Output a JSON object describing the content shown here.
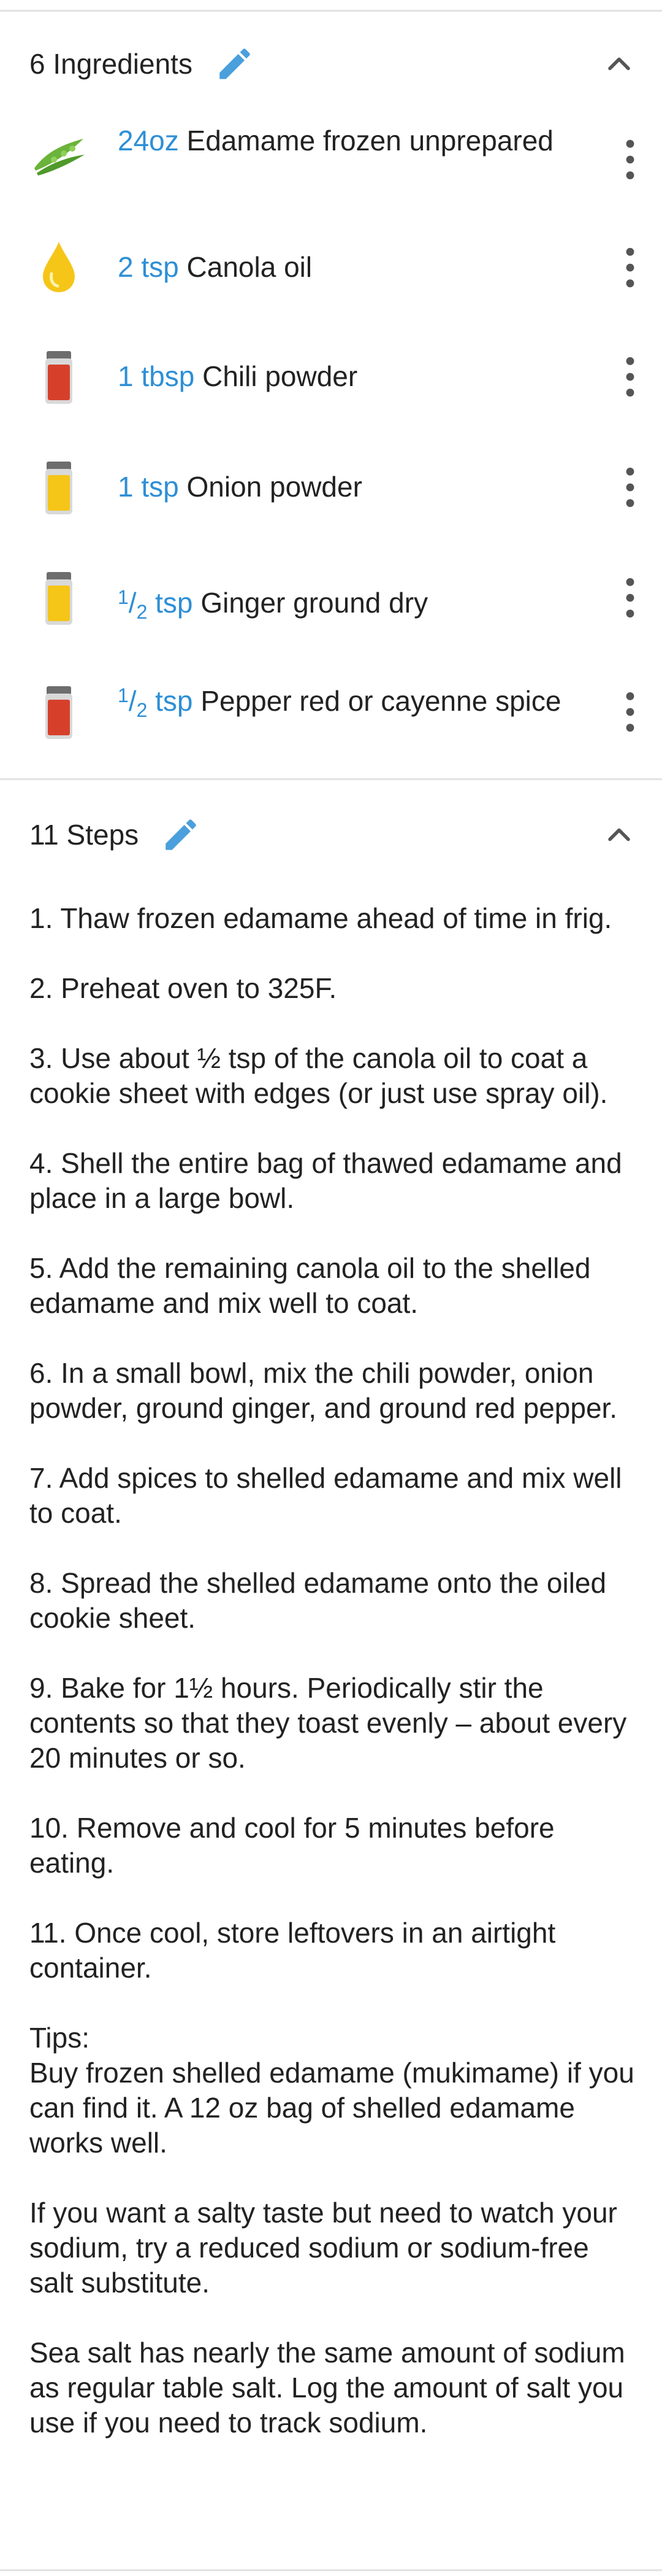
{
  "ingredients_section": {
    "title": "6 Ingredients",
    "items": [
      {
        "icon": "edamame-icon",
        "qty": "24oz",
        "name": "Edamame frozen unprepared"
      },
      {
        "icon": "oil-drop-icon",
        "qty": "2 tsp",
        "name": "Canola oil"
      },
      {
        "icon": "red-spice-jar-icon",
        "qty": "1 tbsp",
        "name": "Chili powder"
      },
      {
        "icon": "yellow-spice-jar-icon",
        "qty": "1 tsp",
        "name": "Onion powder"
      },
      {
        "icon": "yellow-spice-jar-icon",
        "qty_num": "1",
        "qty_den": "2",
        "qty_unit": " tsp",
        "name": "Ginger ground dry"
      },
      {
        "icon": "red-spice-jar-icon",
        "qty_num": "1",
        "qty_den": "2",
        "qty_unit": " tsp",
        "name": "Pepper red or cayenne spice"
      }
    ]
  },
  "steps_section": {
    "title": "11 Steps",
    "items": [
      "1. Thaw frozen edamame ahead of time in frig.",
      "2. Preheat oven to 325F.",
      "3. Use about ½ tsp of the canola oil to coat a cookie sheet with edges (or just use spray oil).",
      "4. Shell the entire bag of thawed edamame and place in a large bowl.",
      "5. Add the remaining canola oil to the shelled edamame and mix well to coat.",
      "6. In a small bowl, mix the chili powder, onion powder, ground ginger, and ground red pepper.",
      "7. Add spices to shelled edamame and mix well to coat.",
      "8. Spread the shelled edamame onto the oiled cookie sheet.",
      "9. Bake for 1½ hours.  Periodically stir the contents so that they toast evenly – about every\n20 minutes or so.",
      "10. Remove and cool for 5 minutes before eating.",
      "11. Once cool, store leftovers in an airtight container.",
      "Tips:\nBuy frozen shelled edamame (mukimame) if you can find it.  A 12 oz bag of shelled edamame works well.",
      "If you want a salty taste but need to watch your sodium, try a reduced sodium or sodium-free salt substitute.",
      "Sea salt has nearly the same amount of sodium as regular table salt.  Log the amount of salt you use if you need to track sodium."
    ]
  },
  "colors": {
    "accent": "#2d8fd6",
    "divider": "#e3e3e3",
    "text": "#222222",
    "icon_grey": "#555555"
  }
}
